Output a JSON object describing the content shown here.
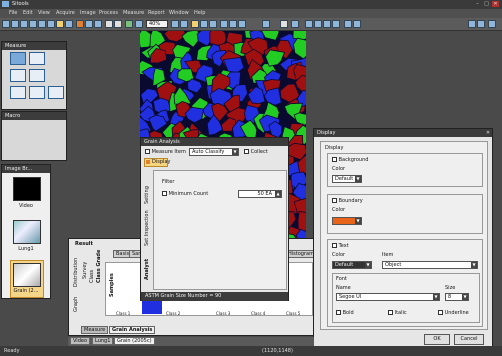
{
  "app": {
    "title": "Sitools",
    "min_label": "–",
    "max_label": "□",
    "close_label": "✕"
  },
  "menu": [
    "File",
    "Edit",
    "View",
    "Acquire",
    "Image",
    "Process",
    "Measure",
    "Report",
    "Window",
    "Help"
  ],
  "toolbar": {
    "zoom": "40%"
  },
  "measure_panel": {
    "title": "Measure"
  },
  "macro_panel": {
    "title": "Macro"
  },
  "image_browser": {
    "title": "Image Br...",
    "items": [
      {
        "label": "Video"
      },
      {
        "label": "Lung1"
      },
      {
        "label": "Grain (2..."
      }
    ]
  },
  "grain_dialog": {
    "title": "Grain Analysis",
    "measure_item_label": "Measure Item",
    "measure_item_value": "Auto Classify",
    "collect_label": "Collect",
    "display_label": "Display",
    "vtabs": [
      "Setting",
      "Set Inspection",
      "Analyst"
    ],
    "filter_label": "Filter",
    "min_count_label": "Minimum Count",
    "min_count_value": "50 EA",
    "footer": "ASTM Grain Size Number = 90"
  },
  "display_dialog": {
    "title": "Display",
    "group_label": "Display",
    "background_label": "Background",
    "bg_color_label": "Color",
    "bg_color_value": "Default",
    "boundary_label": "Boundary",
    "boundary_color_label": "Color",
    "text_label": "Text",
    "text_color_label": "Color",
    "text_color_value": "Default",
    "item_label": "Item",
    "item_value": "Object",
    "font_label": "Font",
    "name_label": "Name",
    "size_label": "Size",
    "font_value": "Segoe UI",
    "size_value": "8",
    "bold_label": "Bold",
    "italic_label": "Italic",
    "underline_label": "Underline",
    "ok_label": "OK",
    "cancel_label": "Cancel",
    "boundary_color": "#e8641a"
  },
  "result_panel": {
    "title": "Result",
    "tabs": [
      "Basis",
      "Sam",
      "Histogram"
    ],
    "vtabs": [
      "Class",
      "Class Grade",
      "Survey",
      "Distribution",
      "Graph"
    ],
    "samples_label": "Samples",
    "x_ticks": [
      "Class 1",
      "Class 2",
      "Class 3",
      "Class 4",
      "Class 5"
    ],
    "bottom_tabs": [
      "Measure",
      "Grain Analysis"
    ]
  },
  "doc_tabs": [
    "Video",
    "Lung1",
    "Grain (2005c)"
  ],
  "status": {
    "left": "Ready",
    "right": "(1120,1148)"
  },
  "colors": {
    "accent": "#2d5e94",
    "grain_red": "#a01010",
    "grain_green": "#22cc22",
    "grain_blue": "#2030e0"
  }
}
